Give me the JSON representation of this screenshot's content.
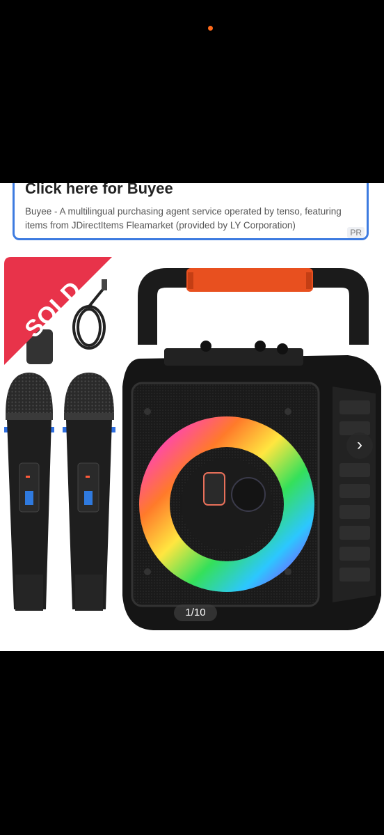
{
  "ad": {
    "title": "Click here for Buyee",
    "description": "Buyee - A multilingual purchasing agent service operated by tenso, featuring items from JDirectItems Fleamarket (provided by LY Corporation)",
    "pr_label": "PR"
  },
  "product": {
    "sold_label": "SOLD",
    "image_counter": "1/10",
    "next_icon": "chevron-right-icon"
  },
  "colors": {
    "sold_badge": "#e8334a",
    "ad_border": "#3d7be0",
    "status_dot": "#ff6a1a"
  }
}
